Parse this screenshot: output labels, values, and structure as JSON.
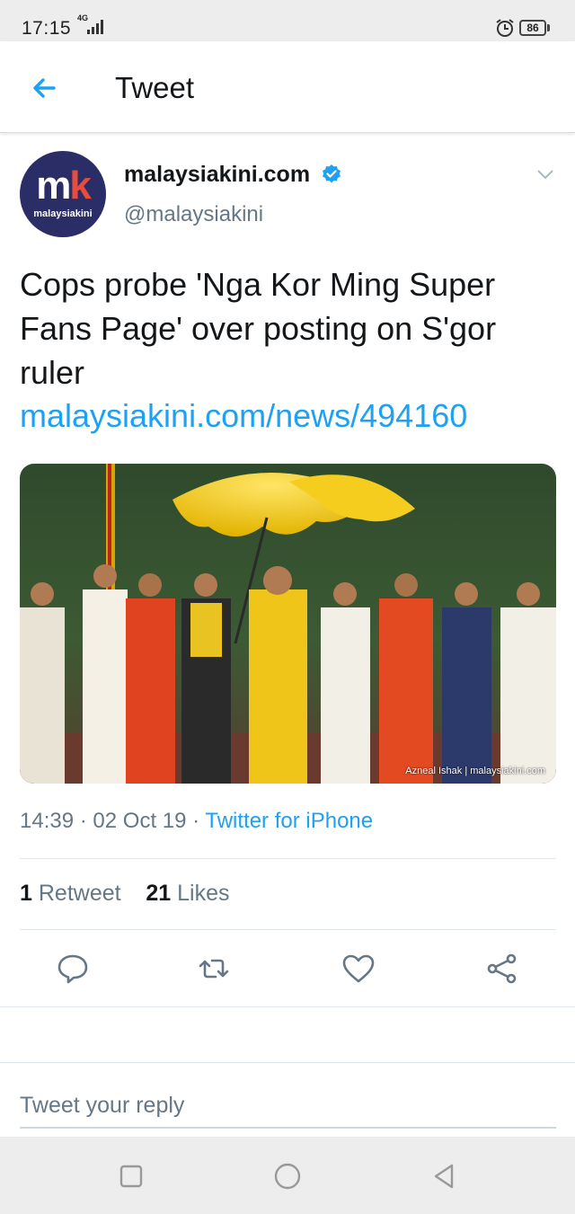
{
  "status_bar": {
    "time": "17:15",
    "network": "4G",
    "battery": "86"
  },
  "header": {
    "title": "Tweet",
    "back_icon": "arrow-left-icon"
  },
  "tweet": {
    "author": {
      "name": "malaysiakini.com",
      "handle": "@malaysiakini",
      "avatar_letters": "mk",
      "avatar_wordmark": "malaysiakini",
      "verified": true
    },
    "text": "Cops probe 'Nga Kor Ming Super Fans Page' over posting on S'gor ruler",
    "link": "malaysiakini.com/news/494160",
    "photo_credit": "Azneal Ishak | malaysiakini.com",
    "time": "14:39",
    "date": "02 Oct 19",
    "separator": "·",
    "source": "Twitter for iPhone",
    "retweets_count": "1",
    "retweets_label": "Retweet",
    "likes_count": "21",
    "likes_label": "Likes"
  },
  "actions": [
    "reply-icon",
    "retweet-icon",
    "like-icon",
    "share-icon"
  ],
  "reply": {
    "placeholder": "Tweet your reply"
  },
  "colors": {
    "accent": "#1da1f2",
    "text": "#14171a",
    "secondary": "#657786",
    "avatar_bg": "#2b2d66"
  }
}
